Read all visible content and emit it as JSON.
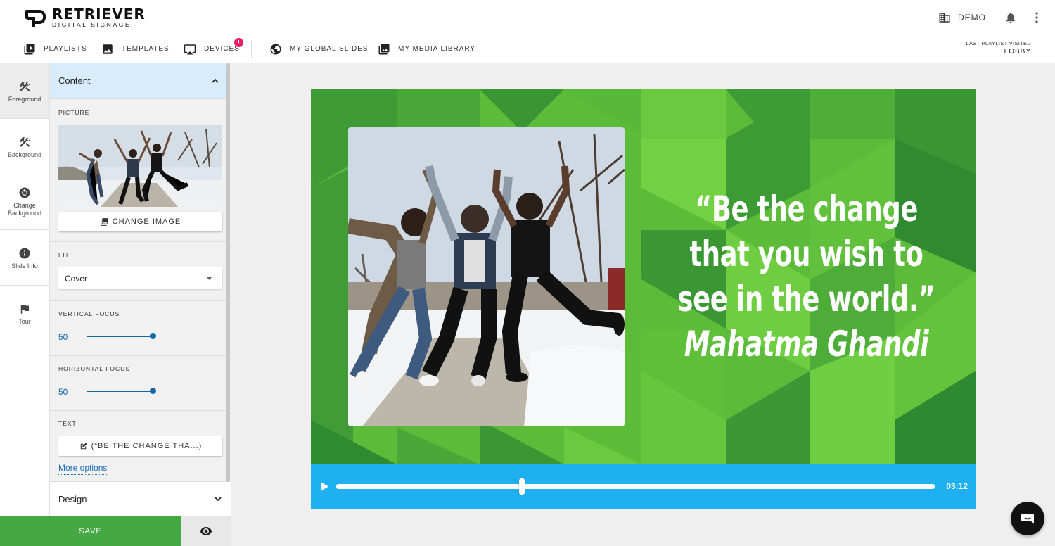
{
  "app": {
    "logo_main": "RETRIEVER",
    "logo_sub": "DIGITAL SIGNAGE",
    "org_name": "DEMO",
    "brand_color": "#44a843",
    "accent_color": "#1fb0f2"
  },
  "nav": {
    "items": [
      {
        "label": "PLAYLISTS",
        "icon": "playlist-icon"
      },
      {
        "label": "TEMPLATES",
        "icon": "image-icon"
      },
      {
        "label": "DEVICES",
        "icon": "cast-icon",
        "badge": "!"
      },
      {
        "label": "MY GLOBAL SLIDES",
        "icon": "globe-icon"
      },
      {
        "label": "MY MEDIA LIBRARY",
        "icon": "media-library-icon"
      }
    ],
    "last_playlist_label": "LAST PLAYLIST VISITED",
    "last_playlist_value": "LOBBY"
  },
  "rail": {
    "items": [
      {
        "label": "Foreground",
        "active": true
      },
      {
        "label": "Background"
      },
      {
        "label": "Change Background"
      },
      {
        "label": "Slide Info"
      },
      {
        "label": "Tour"
      }
    ]
  },
  "panel": {
    "content_header": "Content",
    "picture_label": "PICTURE",
    "change_image_label": "CHANGE IMAGE",
    "fit_label": "FIT",
    "fit_value": "Cover",
    "vertical_focus_label": "VERTICAL FOCUS",
    "vertical_focus_value": "50",
    "horizontal_focus_label": "HORIZONTAL FOCUS",
    "horizontal_focus_value": "50",
    "text_label": "TEXT",
    "text_button_label": "(“BE THE CHANGE THA...)",
    "more_options": "More options",
    "design_header": "Design"
  },
  "actions": {
    "save_label": "SAVE"
  },
  "slide": {
    "quote": "“Be the change that you wish to see in the world.”",
    "author": "Mahatma Ghandi"
  },
  "player": {
    "time": "03:12",
    "progress": 0.31
  }
}
